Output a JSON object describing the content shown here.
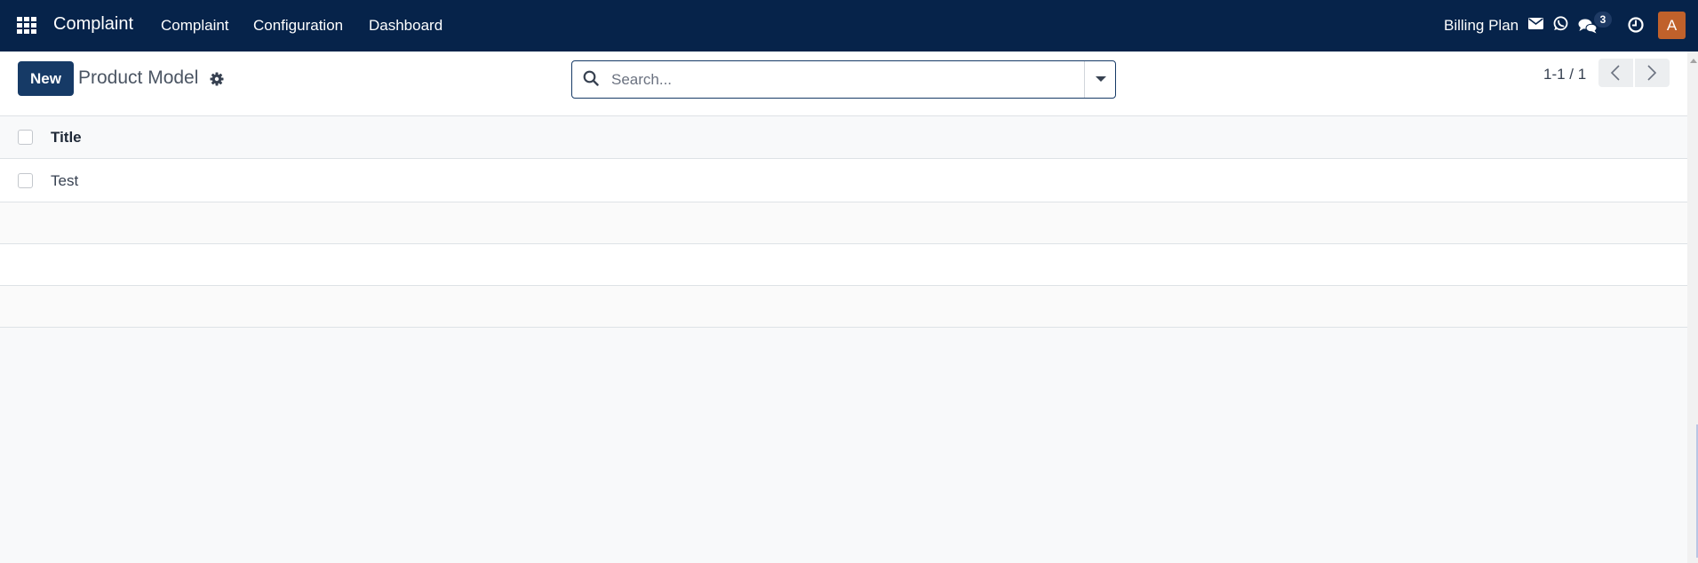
{
  "navbar": {
    "app_name": "Complaint",
    "menu": [
      {
        "label": "Complaint"
      },
      {
        "label": "Configuration"
      },
      {
        "label": "Dashboard"
      }
    ],
    "billing_plan": "Billing Plan",
    "chat_badge_count": "3",
    "avatar_initial": "A",
    "icons": [
      "apps-grid-icon",
      "envelope-icon",
      "whatsapp-icon",
      "chat-icon",
      "clock-icon"
    ]
  },
  "control_panel": {
    "new_button": "New",
    "breadcrumb_title": "Product Model",
    "search": {
      "placeholder": "Search...",
      "value": ""
    },
    "pager": {
      "value": "1-1 / 1"
    }
  },
  "list": {
    "columns": [
      {
        "label": "Title"
      }
    ],
    "rows": [
      {
        "title": "Test"
      }
    ]
  },
  "colors": {
    "navbar_bg": "#06234a",
    "primary": "#163a66",
    "avatar_bg": "#c0612b"
  }
}
